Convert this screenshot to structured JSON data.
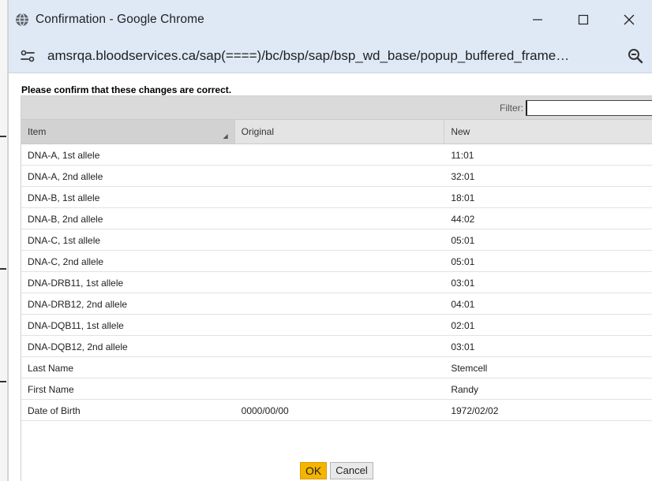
{
  "window": {
    "title": "Confirmation - Google Chrome",
    "url": "amsrqa.bloodservices.ca/sap(====)/bc/bsp/sap/bsp_wd_base/popup_buffered_frame…"
  },
  "dialog": {
    "heading": "Please confirm that these changes are correct.",
    "filter_label": "Filter:",
    "filter_value": ""
  },
  "table": {
    "columns": [
      "Item",
      "Original",
      "New"
    ],
    "rows": [
      {
        "item": "DNA-A, 1st allele",
        "original": "",
        "new": "11:01"
      },
      {
        "item": "DNA-A, 2nd allele",
        "original": "",
        "new": "32:01"
      },
      {
        "item": "DNA-B, 1st allele",
        "original": "",
        "new": "18:01"
      },
      {
        "item": "DNA-B, 2nd allele",
        "original": "",
        "new": "44:02"
      },
      {
        "item": "DNA-C, 1st allele",
        "original": "",
        "new": "05:01"
      },
      {
        "item": "DNA-C, 2nd allele",
        "original": "",
        "new": "05:01"
      },
      {
        "item": "DNA-DRB11, 1st allele",
        "original": "",
        "new": "03:01"
      },
      {
        "item": "DNA-DRB12, 2nd allele",
        "original": "",
        "new": "04:01"
      },
      {
        "item": "DNA-DQB11, 1st allele",
        "original": "",
        "new": "02:01"
      },
      {
        "item": "DNA-DQB12, 2nd allele",
        "original": "",
        "new": "03:01"
      },
      {
        "item": "Last Name",
        "original": "",
        "new": "Stemcell"
      },
      {
        "item": "First Name",
        "original": "",
        "new": "Randy"
      },
      {
        "item": "Date of Birth",
        "original": "0000/00/00",
        "new": "1972/02/02"
      }
    ]
  },
  "buttons": {
    "ok": "OK",
    "cancel": "Cancel"
  },
  "colors": {
    "ok_button": "#f4b400",
    "titlebar": "#dfe9f5"
  }
}
